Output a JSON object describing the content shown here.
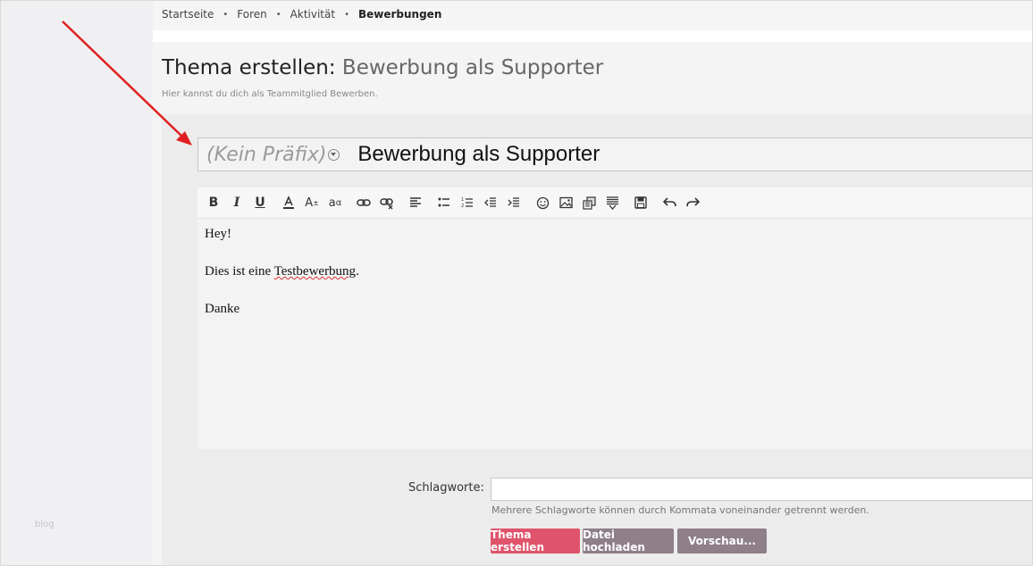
{
  "sidebar": {
    "watermark": "blog"
  },
  "breadcrumb": {
    "items": [
      "Startseite",
      "Foren",
      "Aktivität"
    ],
    "current": "Bewerbungen",
    "separator": "•"
  },
  "page": {
    "title_prefix": "Thema erstellen:",
    "title_thread": "Bewerbung als Supporter",
    "subtitle": "Hier kannst du dich als Teammitglied Bewerben."
  },
  "form": {
    "prefix_placeholder": "(Kein Präfix)",
    "title_value": "Bewerbung als Supporter",
    "toolbar_icons": [
      "bold-icon",
      "italic-icon",
      "underline-icon",
      "text-color-icon",
      "font-size-icon",
      "font-family-icon",
      "link-icon",
      "unlink-icon",
      "align-icon",
      "bullet-list-icon",
      "numbered-list-icon",
      "outdent-icon",
      "indent-icon",
      "smilie-icon",
      "image-icon",
      "media-icon",
      "insert-icon",
      "save-draft-icon",
      "undo-icon",
      "redo-icon"
    ],
    "editor": {
      "line1": "Hey!",
      "line2_before": "Dies ist eine ",
      "line2_misspelled": "Testbewerbung",
      "line2_after": ".",
      "line3": "Danke"
    },
    "tags": {
      "label": "Schlagworte:",
      "value": "",
      "hint": "Mehrere Schlagworte können durch Kommata voneinander getrennt werden."
    },
    "buttons": {
      "create": "Thema erstellen",
      "upload": "Datei hochladen",
      "preview": "Vorschau..."
    }
  },
  "colors": {
    "primary": "#e0546b",
    "secondary": "#8e7f89",
    "arrow": "#e02020"
  }
}
